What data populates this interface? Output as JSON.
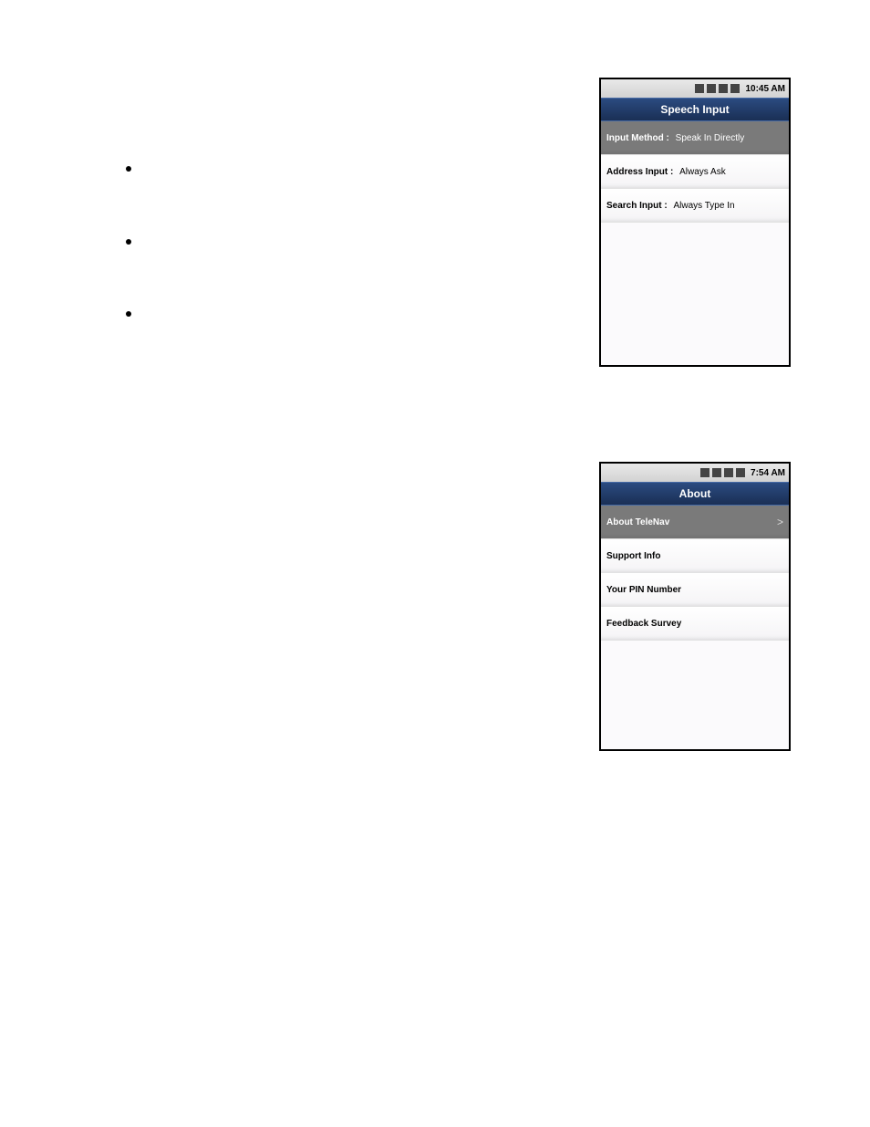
{
  "bullets": [
    {
      "text": ""
    },
    {
      "text": ""
    },
    {
      "text": ""
    }
  ],
  "phone1": {
    "status": {
      "time": "10:45 AM",
      "icons": [
        "bluetooth-icon",
        "data-icon",
        "signal-icon",
        "help-icon"
      ]
    },
    "title": "Speech Input",
    "rows": [
      {
        "label": "Input Method :",
        "value": "Speak In Directly",
        "dark": true
      },
      {
        "label": "Address Input :",
        "value": "Always Ask",
        "dark": false
      },
      {
        "label": "Search Input :",
        "value": "Always Type In",
        "dark": false
      }
    ]
  },
  "phone2": {
    "status": {
      "time": "7:54 AM",
      "icons": [
        "bluetooth-icon",
        "data-icon",
        "signal-icon",
        "help-icon"
      ]
    },
    "title": "About",
    "rows": [
      {
        "label": "About TeleNav",
        "value": "",
        "dark": true,
        "chevron": true
      },
      {
        "label": "Support Info",
        "value": "",
        "dark": false
      },
      {
        "label": "Your PIN Number",
        "value": "",
        "dark": false
      },
      {
        "label": "Feedback Survey",
        "value": "",
        "dark": false
      }
    ]
  }
}
